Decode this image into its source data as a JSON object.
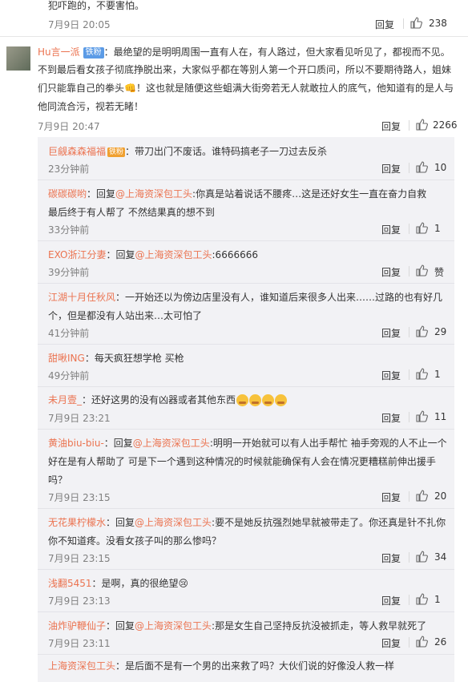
{
  "top": {
    "text": "犯吓跑的，不要害怕。",
    "time": "7月9日 20:05",
    "reply": "回复",
    "likes": "238"
  },
  "main": {
    "user": "Hu言一派",
    "badge": "铁粉",
    "lines": [
      "：最绝望的是明明周围一直有人在，有人路过，但大家看见听见了，都视而不见。",
      "不到最后看女孩子彻底挣脱出来，大家似乎都在等别人第一个开口质问，所以不要期待路人，姐妹",
      "们只能靠自己的拳头👊！这也就是随便这些蛆满大街旁若无人就敢拉人的底气，他知道有的是人与",
      "他同流合污，视若无睹！"
    ],
    "time": "7月9日 20:47",
    "reply": "回复",
    "likes": "2266"
  },
  "comments": [
    {
      "user": "巨觎森森福福",
      "badge": "铁粉",
      "text": "：带刀出门不废话。谁特码搞老子一刀过去反杀",
      "time": "23分钟前",
      "reply": "回复",
      "likes": "10"
    },
    {
      "user": "碳碳碳哟",
      "prefix": "：回复",
      "at": "@上海资深包工头",
      "text": ":你真是站着说话不腰疼…这是还好女生一直在奋力自救",
      "text2": "最后终于有人帮了 不然结果真的想不到",
      "time": "33分钟前",
      "reply": "回复",
      "likes": "1"
    },
    {
      "user": "EXO浙江分妻",
      "prefix": "：回复",
      "at": "@上海资深包工头",
      "text": ":6666666",
      "time": "39分钟前",
      "reply": "回复",
      "likes": "赞"
    },
    {
      "user": "江湖十月任秋风",
      "text": "：一开始还以为傍边店里没有人，谁知道后来很多人出来……过路的也有好几",
      "text2": "个，但是都没有人站出来…太可怕了",
      "time": "41分钟前",
      "reply": "回复",
      "likes": "29"
    },
    {
      "user": "甜啾ING",
      "text": "：每天疯狂想学枪 买枪",
      "time": "49分钟前",
      "reply": "回复",
      "likes": "1"
    },
    {
      "user": "未月壹_",
      "text": "：还好这男的没有凶器或者其他东西",
      "time": "7月9日 23:21",
      "reply": "回复",
      "likes": "11"
    },
    {
      "user": "黄油biu-biu-",
      "prefix": "：回复",
      "at": "@上海资深包工头",
      "text": ":明明一开始就可以有人出手帮忙 袖手旁观的人不止一个",
      "text2": "好在是有人帮助了 可是下一个遇到这种情况的时候就能确保有人会在情况更糟糕前伸出援手",
      "text3": "吗？",
      "time": "7月9日 23:15",
      "reply": "回复",
      "likes": "20"
    },
    {
      "user": "无花果柠檬水",
      "prefix": "：回复",
      "at": "@上海资深包工头",
      "text": ":要不是她反抗强烈她早就被带走了。你还真是针不扎你",
      "text2": "你不知道疼。没看女孩子叫的那么惨吗？",
      "time": "7月9日 23:15",
      "reply": "回复",
      "likes": "34"
    },
    {
      "user": "浅翻5451",
      "text": "：是啊，真的很绝望😢",
      "time": "7月9日 23:13",
      "reply": "回复",
      "likes": "1"
    },
    {
      "user": "油炸驴鞭仙子",
      "prefix": "：回复",
      "at": "@上海资深包工头",
      "text": ":那是女生自己坚持反抗没被抓走，等人救早就死了",
      "time": "7月9日 23:11",
      "reply": "回复",
      "likes": "26"
    },
    {
      "user": "上海资深包工头",
      "text": "：是后面不是有一个男的出来救了吗？大伙们说的好像没人救一样",
      "time": "",
      "reply": "",
      "likes": ""
    }
  ],
  "colors": {
    "username": "#eb7350",
    "link": "#eb7350",
    "badge": "#5b9be6",
    "panel": "#f2f2f5"
  }
}
